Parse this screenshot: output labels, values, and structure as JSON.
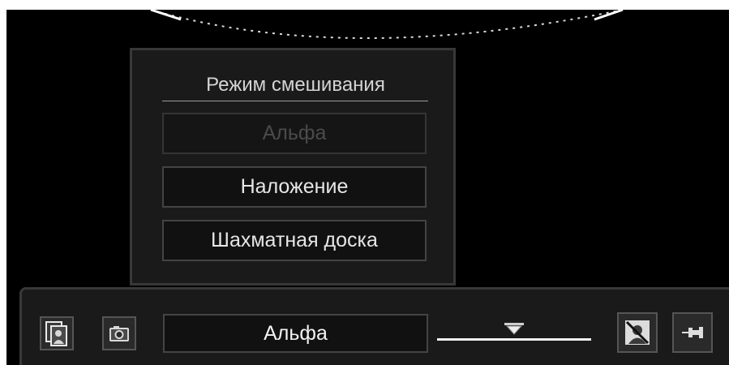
{
  "blend_menu": {
    "title": "Режим смешивания",
    "options": [
      {
        "label": "Альфа",
        "disabled": true
      },
      {
        "label": "Наложение",
        "disabled": false
      },
      {
        "label": "Шахматная доска",
        "disabled": false
      }
    ]
  },
  "toolbar": {
    "blend_mode_value": "Альфа",
    "opacity_level": 0.5,
    "buttons": [
      {
        "icon": "portrait-layers-icon"
      },
      {
        "icon": "camera-icon"
      },
      {
        "icon": "hide-person-icon"
      },
      {
        "icon": "pin-icon"
      }
    ]
  },
  "colors": {
    "background": "#000000",
    "panel": "#1a1a1a",
    "panel_border": "#383838",
    "text": "#e6e6e6",
    "disabled_text": "#4b4b4b"
  }
}
